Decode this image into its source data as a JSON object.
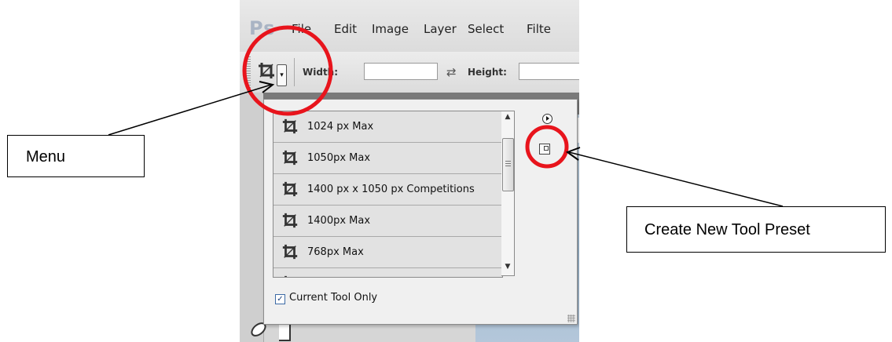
{
  "app": {
    "logo": "Ps",
    "menus": [
      "File",
      "Edit",
      "Image",
      "Layer",
      "Select",
      "Filte"
    ]
  },
  "options_bar": {
    "width_label": "Width:",
    "height_label": "Height:",
    "width_value": "",
    "height_value": ""
  },
  "preset_panel": {
    "presets": [
      "1024 px Max",
      "1050px Max",
      "1400 px x 1050 px Competitions",
      "1400px Max",
      "768px Max"
    ],
    "current_tool_only_label": "Current Tool Only",
    "current_tool_only_checked": true
  },
  "annotations": {
    "menu_label": "Menu",
    "new_preset_label": "Create New Tool Preset",
    "highlight_color": "#e8141c"
  }
}
